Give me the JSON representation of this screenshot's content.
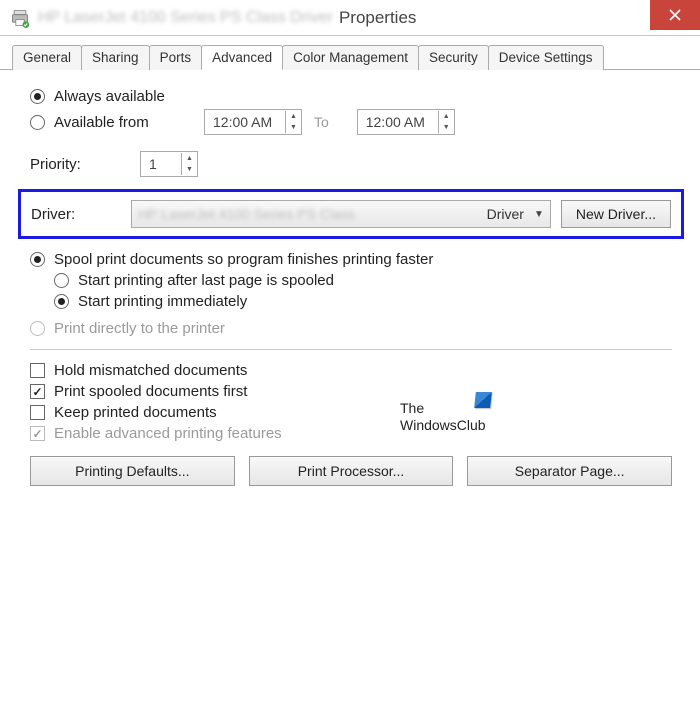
{
  "titlebar": {
    "blurred_prefix": "HP LaserJet 4100 Series PS Class Driver",
    "title": "Properties"
  },
  "tabs": {
    "general": "General",
    "sharing": "Sharing",
    "ports": "Ports",
    "advanced": "Advanced",
    "color": "Color Management",
    "security": "Security",
    "device": "Device Settings",
    "active": "advanced"
  },
  "availability": {
    "always": "Always available",
    "from": "Available from",
    "time_from": "12:00 AM",
    "to_label": "To",
    "time_to": "12:00 AM",
    "selected": "always"
  },
  "priority": {
    "label": "Priority:",
    "value": "1"
  },
  "driver": {
    "label": "Driver:",
    "blurred": "HP LaserJet 4100 Series PS Class",
    "visible": "Driver",
    "button": "New Driver..."
  },
  "spool": {
    "spool": "Spool print documents so program finishes printing faster",
    "after_last": "Start printing after last page is spooled",
    "immediate": "Start printing immediately",
    "direct": "Print directly to the printer"
  },
  "options": {
    "hold": "Hold mismatched documents",
    "spooled_first": "Print spooled documents first",
    "keep": "Keep printed documents",
    "enable_adv": "Enable advanced printing features"
  },
  "buttons": {
    "defaults": "Printing Defaults...",
    "processor": "Print Processor...",
    "separator": "Separator Page..."
  },
  "watermark": {
    "line1": "The",
    "line2": "WindowsClub"
  }
}
